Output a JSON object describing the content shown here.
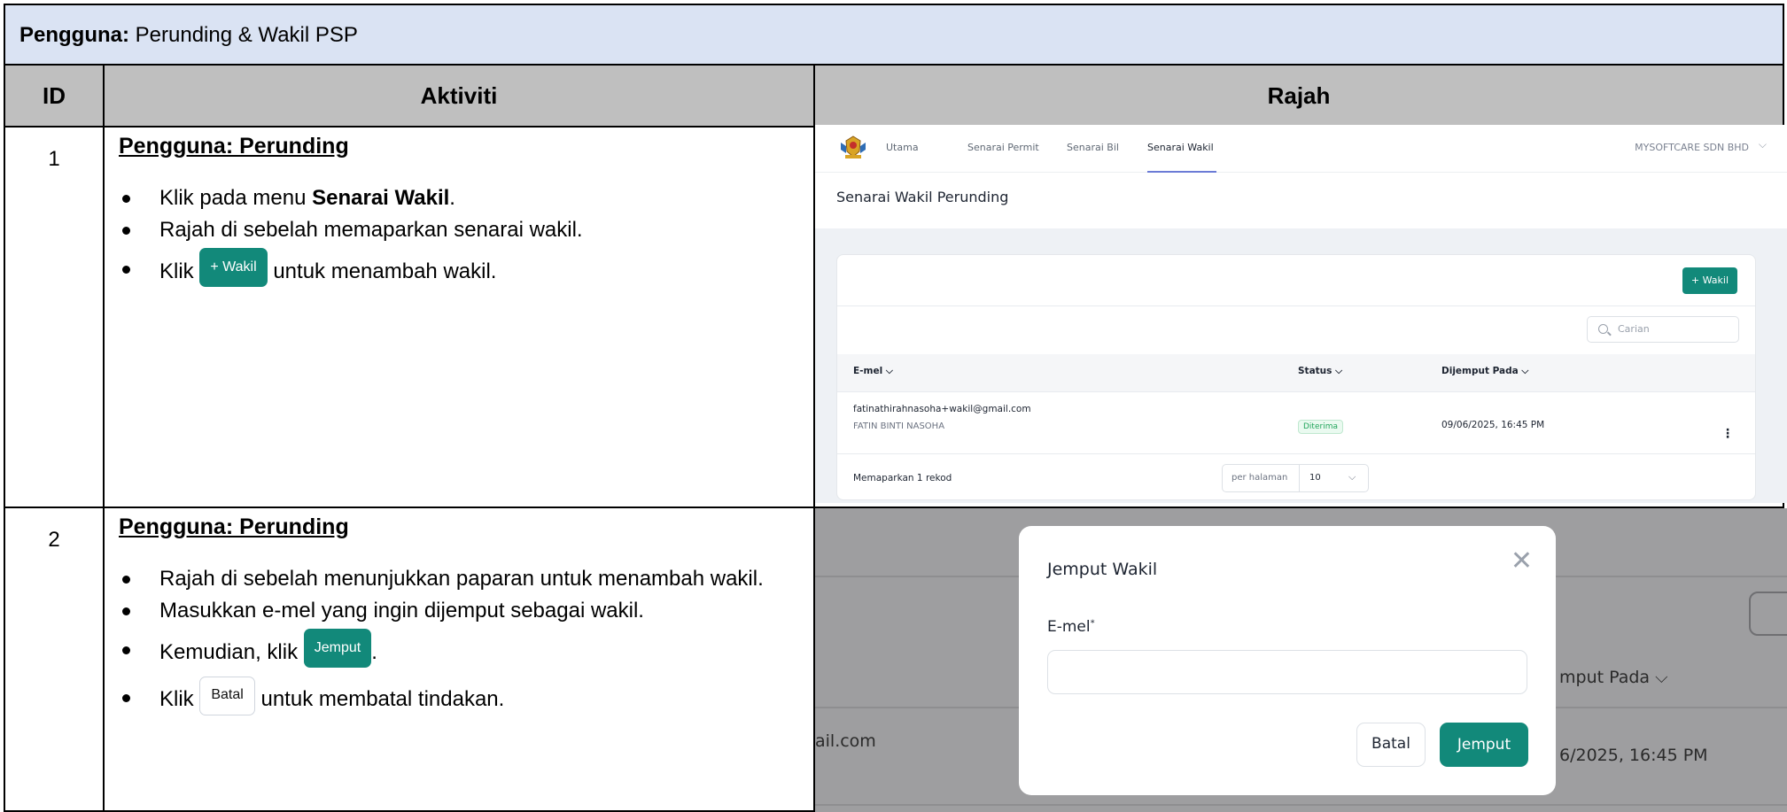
{
  "header": {
    "user_label": "Pengguna:",
    "user_value": " Perunding & Wakil PSP"
  },
  "columns": {
    "id": "ID",
    "activity": "Aktiviti",
    "figure": "Rajah"
  },
  "rows": [
    {
      "id": "1",
      "title": "Pengguna: Perunding",
      "b1_pre": "Klik pada menu ",
      "b1_bold": "Senarai Wakil",
      "b1_post": ".",
      "b2": "Rajah di sebelah memaparkan senarai wakil.",
      "b3_pre": "Klik ",
      "b3_btn": "+ Wakil",
      "b3_post": " untuk menambah wakil."
    },
    {
      "id": "2",
      "title": "Pengguna: Perunding",
      "b1": "Rajah di sebelah menunjukkan paparan untuk menambah wakil.",
      "b2": "Masukkan e-mel yang ingin dijemput sebagai wakil.",
      "b3_pre": "Kemudian, klik ",
      "b3_btn": "Jemput",
      "b3_post": ".",
      "b4_pre": "Klik ",
      "b4_btn": "Batal",
      "b4_post": " untuk membatal tindakan."
    }
  ],
  "shot1": {
    "nav": [
      "Utama",
      "Senarai Permit",
      "Senarai Bil",
      "Senarai Wakil"
    ],
    "company": "MYSOFTCARE SDN BHD",
    "page_title": "Senarai Wakil Perunding",
    "add_button": "+ Wakil",
    "search_placeholder": "Carian",
    "columns": {
      "email": "E-mel",
      "status": "Status",
      "invited": "Dijemput Pada"
    },
    "row": {
      "email": "fatinathirahnasoha+wakil@gmail.com",
      "name": "FATIN BINTI NASOHA",
      "status": "Diterima",
      "date": "09/06/2025, 16:45 PM"
    },
    "footer": {
      "count": "Memaparkan 1 rekod",
      "per_page_label": "per halaman",
      "per_page_value": "10"
    }
  },
  "shot2": {
    "bg_email_fragment": "ail.com",
    "bg_col_fragment": "mput Pada",
    "bg_date_fragment": "6/2025, 16:45 PM",
    "modal": {
      "title": "Jemput Wakil",
      "label": "E-mel",
      "required_mark": "*",
      "cancel": "Batal",
      "submit": "Jemput"
    }
  },
  "colors": {
    "header_bg": "#dae3f3",
    "colhead_bg": "#bfbfbf",
    "accent": "#12897a",
    "overlay": "#9e9ea0"
  },
  "icons": [
    "crest-icon",
    "chevron-down-icon",
    "search-icon",
    "kebab-menu-icon",
    "close-icon"
  ]
}
